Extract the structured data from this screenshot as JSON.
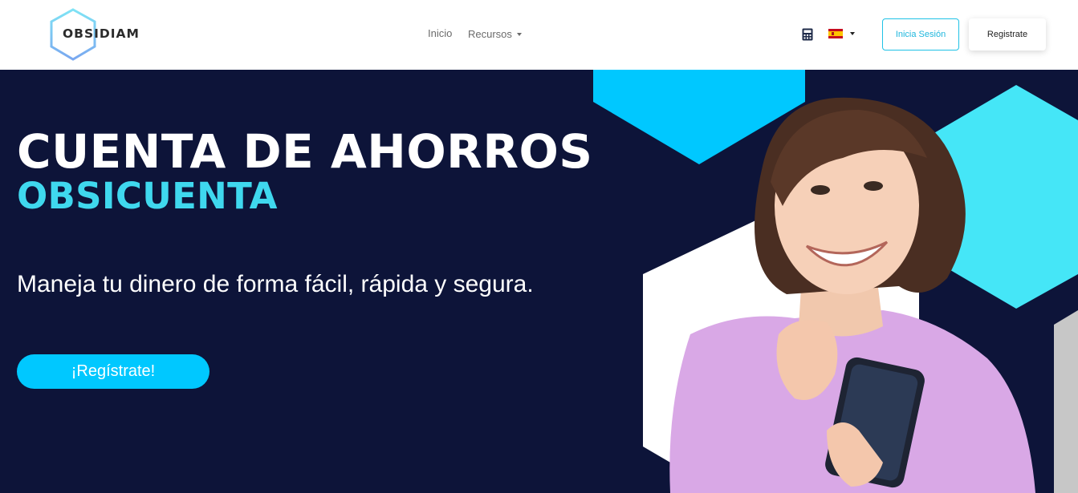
{
  "brand": {
    "name": "OBSIDIAM",
    "accent": "#1fc2e6",
    "dark_bg": "#0d1439"
  },
  "nav": {
    "items": [
      {
        "label": "Inicio"
      },
      {
        "label": "Recursos"
      }
    ]
  },
  "header_tools": {
    "calculator_icon": "calculator-icon",
    "language_flag": "spain-flag-icon"
  },
  "auth": {
    "login_label": "Inicia Sesión",
    "register_label": "Registrate"
  },
  "hero": {
    "title": "CUENTA DE AHORROS",
    "subtitle": "OBSICUENTA",
    "text": "Maneja tu dinero de forma fácil, rápida y segura.",
    "cta_label": "¡Regístrate!",
    "colors": {
      "title": "#ffffff",
      "subtitle": "#3fd8ee",
      "cta": "#00c8ff",
      "hex_light": "#00c8ff",
      "hex_bright": "#45e6f7",
      "hex_white": "#ffffff",
      "hex_gray": "#c7c7c7"
    }
  }
}
